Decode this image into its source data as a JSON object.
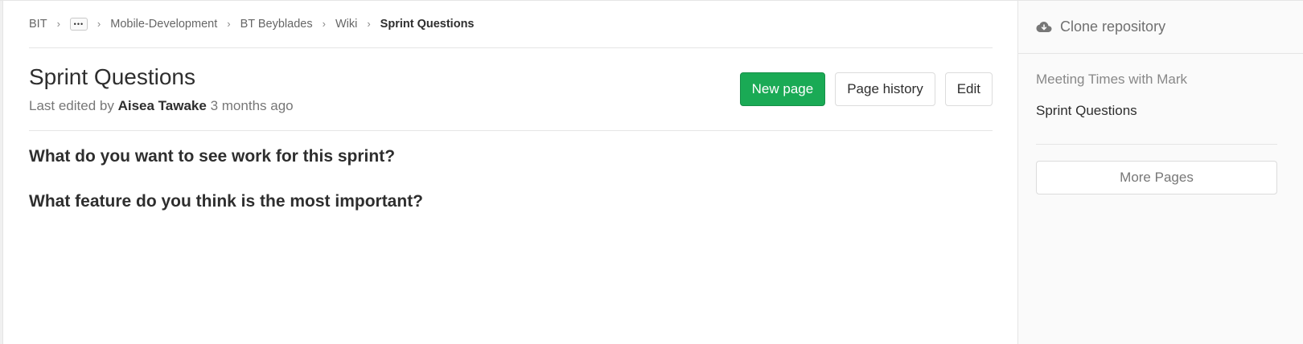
{
  "breadcrumb": {
    "items": [
      "BIT",
      "Mobile-Development",
      "BT Beyblades",
      "Wiki"
    ],
    "ellipsis": "•••",
    "current": "Sprint Questions"
  },
  "page": {
    "title": "Sprint Questions",
    "edited_prefix": "Last edited by",
    "author": "Aisea Tawake",
    "edited_time": "3 months ago"
  },
  "actions": {
    "new_page": "New page",
    "page_history": "Page history",
    "edit": "Edit"
  },
  "content": {
    "headings": [
      "What do you want to see work for this sprint?",
      "What feature do you think is the most important?"
    ]
  },
  "sidebar": {
    "clone_label": "Clone repository",
    "clone_icon": "cloud-download-icon",
    "pages": [
      {
        "label": "Meeting Times with Mark",
        "active": false
      },
      {
        "label": "Sprint Questions",
        "active": true
      }
    ],
    "more_pages": "More Pages"
  },
  "colors": {
    "primary": "#1aaa55",
    "sidebar_bg": "#fafafa",
    "border": "#e5e5e5"
  }
}
